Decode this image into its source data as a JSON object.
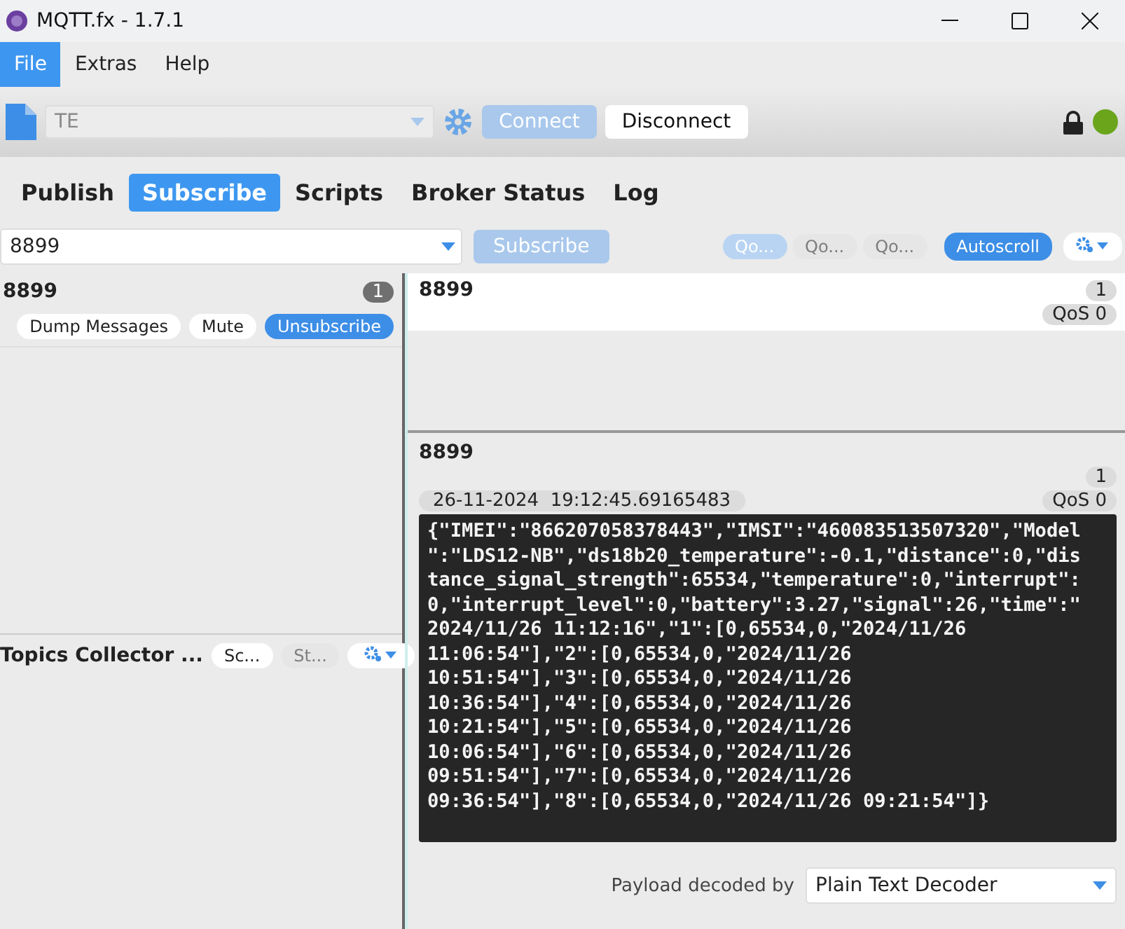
{
  "window": {
    "title": "MQTT.fx - 1.7.1"
  },
  "menu": [
    {
      "label": "File",
      "selected": true
    },
    {
      "label": "Extras",
      "selected": false
    },
    {
      "label": "Help",
      "selected": false
    }
  ],
  "toolbar": {
    "profile": {
      "value": "TE",
      "disabled": true
    },
    "connect": {
      "label": "Connect",
      "disabled": true
    },
    "disconnect": {
      "label": "Disconnect",
      "disabled": false
    },
    "connected": true
  },
  "tabs": [
    {
      "label": "Publish",
      "selected": false
    },
    {
      "label": "Subscribe",
      "selected": true
    },
    {
      "label": "Scripts",
      "selected": false
    },
    {
      "label": "Broker Status",
      "selected": false
    },
    {
      "label": "Log",
      "selected": false
    }
  ],
  "subscribe_bar": {
    "topic": "8899",
    "button": {
      "label": "Subscribe",
      "disabled": true
    },
    "qos_filters": [
      {
        "label": "Qo...",
        "selected": true
      },
      {
        "label": "Qo...",
        "selected": false
      },
      {
        "label": "Qo...",
        "selected": false
      }
    ],
    "autoscroll": {
      "label": "Autoscroll",
      "on": true
    }
  },
  "subscriptions": [
    {
      "topic": "8899",
      "count": "1",
      "actions": [
        {
          "label": "Dump Messages",
          "kind": "plain"
        },
        {
          "label": "Mute",
          "kind": "plain"
        },
        {
          "label": "Unsubscribe",
          "kind": "primary"
        }
      ]
    }
  ],
  "topics_collector": {
    "title": "Topics Collector ...",
    "buttons": [
      {
        "label": "Sc...",
        "disabled": false
      },
      {
        "label": "St...",
        "disabled": true
      }
    ]
  },
  "messages": [
    {
      "topic": "8899",
      "count": "1",
      "qos": "QoS 0"
    }
  ],
  "detail": {
    "topic": "8899",
    "count": "1",
    "timestamp": "26-11-2024  19:12:45.69165483",
    "qos": "QoS 0",
    "payload_lines": [
      "{\"IMEI\":\"866207058378443\",\"IMSI\":\"460083513507320\",\"Model",
      "\":\"LDS12-NB\",\"ds18b20_temperature\":-0.1,\"distance\":0,\"dis",
      "tance_signal_strength\":65534,\"temperature\":0,\"interrupt\":",
      "0,\"interrupt_level\":0,\"battery\":3.27,\"signal\":26,\"time\":\"",
      "2024/11/26 11:12:16\",\"1\":[0,65534,0,\"2024/11/26",
      "11:06:54\"],\"2\":[0,65534,0,\"2024/11/26",
      "10:51:54\"],\"3\":[0,65534,0,\"2024/11/26",
      "10:36:54\"],\"4\":[0,65534,0,\"2024/11/26",
      "10:21:54\"],\"5\":[0,65534,0,\"2024/11/26",
      "10:06:54\"],\"6\":[0,65534,0,\"2024/11/26",
      "09:51:54\"],\"7\":[0,65534,0,\"2024/11/26",
      "09:36:54\"],\"8\":[0,65534,0,\"2024/11/26 09:21:54\"]}"
    ],
    "decoder_label": "Payload decoded by",
    "decoder": "Plain Text Decoder"
  }
}
